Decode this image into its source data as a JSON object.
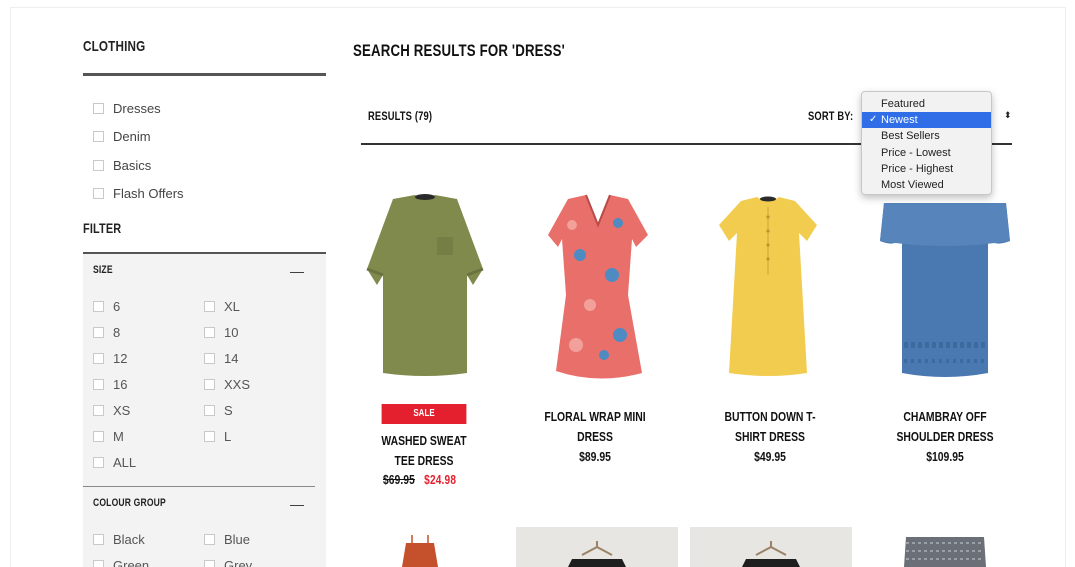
{
  "sidebar": {
    "title": "CLOTHING",
    "categories": [
      {
        "label": "Dresses"
      },
      {
        "label": "Denim"
      },
      {
        "label": "Basics"
      },
      {
        "label": "Flash Offers"
      }
    ],
    "filter_title": "FILTER",
    "size": {
      "heading": "SIZE",
      "toggle": "—",
      "options": [
        "6",
        "XL",
        "8",
        "10",
        "12",
        "14",
        "16",
        "XXS",
        "XS",
        "S",
        "M",
        "L",
        "ALL"
      ]
    },
    "colour": {
      "heading": "COLOUR GROUP",
      "toggle": "—",
      "options": [
        "Black",
        "Blue",
        "Green",
        "Grey"
      ]
    }
  },
  "main": {
    "title": "SEARCH RESULTS FOR 'DRESS'",
    "results_label": "RESULTS (79)",
    "sort_label": "SORT BY:",
    "sort_arrow": "⬍",
    "sort_options": [
      {
        "label": "Featured",
        "selected": false
      },
      {
        "label": "Newest",
        "selected": true
      },
      {
        "label": "Best Sellers",
        "selected": false
      },
      {
        "label": "Price - Lowest",
        "selected": false
      },
      {
        "label": "Price - Highest",
        "selected": false
      },
      {
        "label": "Most Viewed",
        "selected": false
      }
    ],
    "check_mark": "✓"
  },
  "products": [
    {
      "badge": "SALE",
      "name_line1": "WASHED SWEAT",
      "name_line2": "TEE DRESS",
      "old_price": "$69.95",
      "price": "$24.98",
      "color": "#7f8a4c"
    },
    {
      "name_line1": "FLORAL WRAP MINI",
      "name_line2": "DRESS",
      "price": "$89.95",
      "color": "#e86f6a"
    },
    {
      "name_line1": "BUTTON DOWN T-",
      "name_line2": "SHIRT DRESS",
      "price": "$49.95",
      "color": "#f2cc4e"
    },
    {
      "name_line1": "CHAMBRAY OFF",
      "name_line2": "SHOULDER DRESS",
      "price": "$109.95",
      "color": "#4a78b0"
    }
  ],
  "colors": {
    "sale_red": "#e5202e",
    "dropdown_select": "#2f6ee6"
  }
}
